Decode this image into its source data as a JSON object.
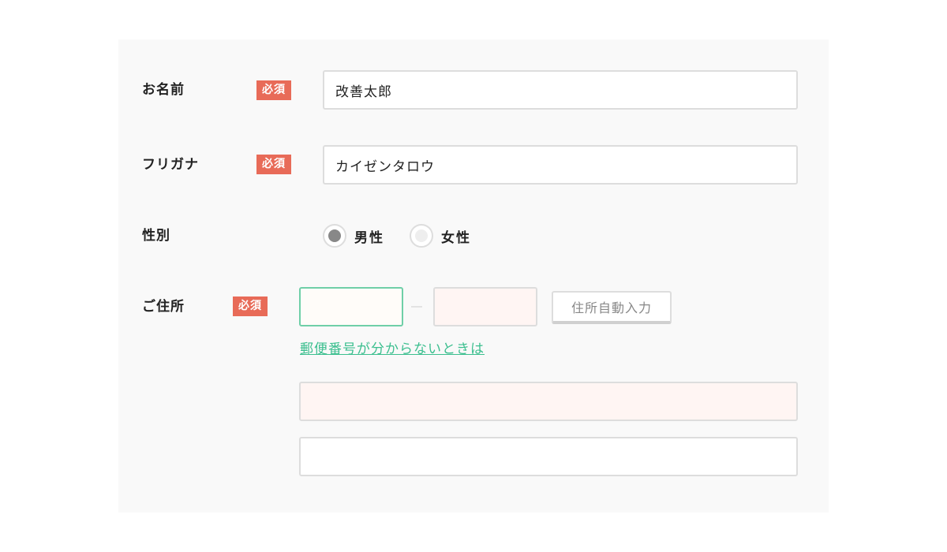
{
  "required_badge": "必須",
  "name": {
    "label": "お名前",
    "value": "改善太郎"
  },
  "furigana": {
    "label": "フリガナ",
    "value": "カイゼンタロウ"
  },
  "gender": {
    "label": "性別",
    "options": [
      {
        "label": "男性",
        "checked": true
      },
      {
        "label": "女性",
        "checked": false
      }
    ]
  },
  "address": {
    "label": "ご住所",
    "postal_first": "",
    "postal_second": "",
    "auto_fill_button": "住所自動入力",
    "postal_help_link": "郵便番号が分からないときは",
    "line1": "",
    "line2": ""
  },
  "colors": {
    "badge": "#e86b58",
    "link": "#3cbf8f",
    "focus_border": "#6fcfa8",
    "error_bg": "#fff5f3"
  }
}
